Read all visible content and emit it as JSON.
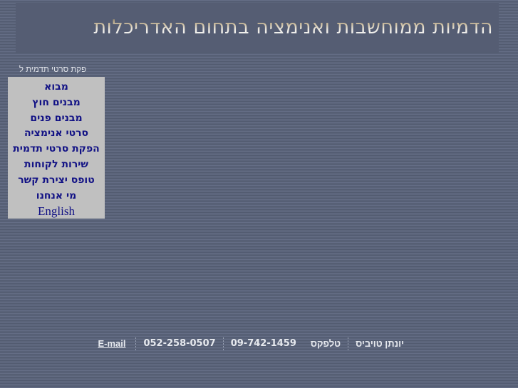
{
  "header": {
    "title": "הדמיות ממוחשבות ואנימציה בתחום האדריכלות"
  },
  "menu": {
    "caption": "פקת סרטי תדמית ל",
    "items": [
      {
        "label": "מבוא",
        "name": "menu-item-intro",
        "script": "hebrew"
      },
      {
        "label": "מבנים חוץ",
        "name": "menu-item-exteriors",
        "script": "hebrew"
      },
      {
        "label": "מבנים פנים",
        "name": "menu-item-interiors",
        "script": "hebrew"
      },
      {
        "label": "סרטי אנימציה",
        "name": "menu-item-animation-films",
        "script": "hebrew"
      },
      {
        "label": "הפקת סרטי תדמית",
        "name": "menu-item-corporate-video",
        "script": "hebrew"
      },
      {
        "label": "שירות לקוחות",
        "name": "menu-item-customer-service",
        "script": "hebrew"
      },
      {
        "label": "טופס יצירת קשר",
        "name": "menu-item-contact-form",
        "script": "hebrew"
      },
      {
        "label": "מי אנחנו",
        "name": "menu-item-about-us",
        "script": "hebrew"
      },
      {
        "label": "English",
        "name": "menu-item-english",
        "script": "latin"
      }
    ]
  },
  "footer": {
    "contact_name": "יונתן טויביס",
    "phone_label": "טלפקס",
    "phone": "09-742-1459",
    "mobile": "052-258-0507",
    "email_label": "E-mail"
  },
  "colors": {
    "page_background": "#596279",
    "header_band": "#555d73",
    "menu_background": "#c0c0c0",
    "menu_text": "#121285",
    "footer_text": "#e6e9ee",
    "title_gold": "#cdbfa2"
  }
}
